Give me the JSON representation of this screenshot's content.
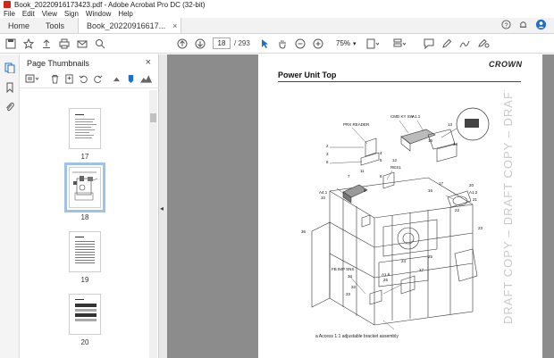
{
  "window": {
    "title": "Book_20220916173423.pdf - Adobe Acrobat Pro DC (32-bit)"
  },
  "menu": [
    "File",
    "Edit",
    "View",
    "Sign",
    "Window",
    "Help"
  ],
  "tabs": {
    "home": "Home",
    "tools": "Tools",
    "document": "Book_20220916617...",
    "close": "×"
  },
  "toolbar": {
    "current_page": "18",
    "total_pages": "/ 293",
    "zoom": "75%"
  },
  "panel": {
    "title": "Page Thumbnails",
    "close": "×",
    "thumbnails": [
      {
        "label": "17"
      },
      {
        "label": "18"
      },
      {
        "label": "19"
      },
      {
        "label": "20"
      }
    ]
  },
  "page": {
    "title": "Power Unit Top",
    "brand": "CROWN",
    "caption": "a    Access 1.1 adjustable bracket assembly",
    "watermark": "DRAFT COPY – DRAFT COPY – DRAFT COPY",
    "callouts": [
      "PRX READER",
      "CMD KY SW",
      "A1.1",
      "13",
      "14",
      "2",
      "3",
      "4",
      "5",
      "6",
      "12",
      "11",
      "8",
      "RES1",
      "A4.1",
      "10",
      "17",
      "16",
      "A1.2",
      "21",
      "22",
      "23",
      "20",
      "36",
      "FB IMP SNS",
      "A1.6",
      "26",
      "24",
      "25",
      "27",
      "32",
      "33",
      "34",
      "9",
      "7",
      "15"
    ]
  },
  "colors": {
    "app_red": "#d8231a",
    "selection_blue": "#9fc3e8",
    "canvas_gray": "#8c8c8c",
    "watermark_gray": "#c9c9c9"
  }
}
